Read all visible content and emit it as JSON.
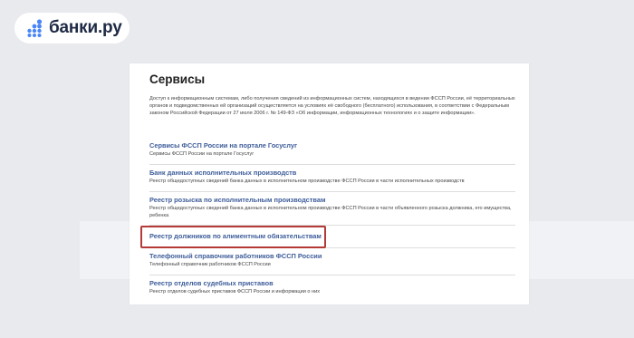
{
  "brand": {
    "name": "банки.ру",
    "colors": {
      "accent": "#4a86f7",
      "text": "#1f2a44"
    }
  },
  "page": {
    "title": "Сервисы",
    "intro": "Доступ к информационным системам, либо получения сведений из информационных систем, находящихся в ведении ФССП России, её территориальных органов и подведомственных ей организаций осуществляется на условиях её свободного (бесплатного) использования, в соответствии с Федеральным законом Российской Федерации от 27 июля 2006 г. № 149-ФЗ «Об информации, информационных технологиях и о защите информации»."
  },
  "services": [
    {
      "title": "Сервисы ФССП России на портале Госуслуг",
      "desc": "Сервисы ФССП России на портале Госуслуг"
    },
    {
      "title": "Банк данных исполнительных производств",
      "desc": "Реестр общедоступных сведений банка данных в исполнительном производстве ФССП России в части исполнительных производств"
    },
    {
      "title": "Реестр розыска по исполнительным производствам",
      "desc": "Реестр общедоступных сведений банка данных в исполнительном производстве ФССП России в части объявленного розыска должника, его имущества, ребенка"
    },
    {
      "title": "Реестр должников по алиментным обязательствам",
      "desc": "",
      "highlighted": true
    },
    {
      "title": "Телефонный справочник работников ФССП России",
      "desc": "Телефонный справочник работников ФССП России"
    },
    {
      "title": "Реестр отделов судебных приставов",
      "desc": "Реестр отделов судебных приставов ФССП России и информации о них"
    }
  ],
  "highlight_color": "#b43a38",
  "link_color": "#3e5d9a"
}
